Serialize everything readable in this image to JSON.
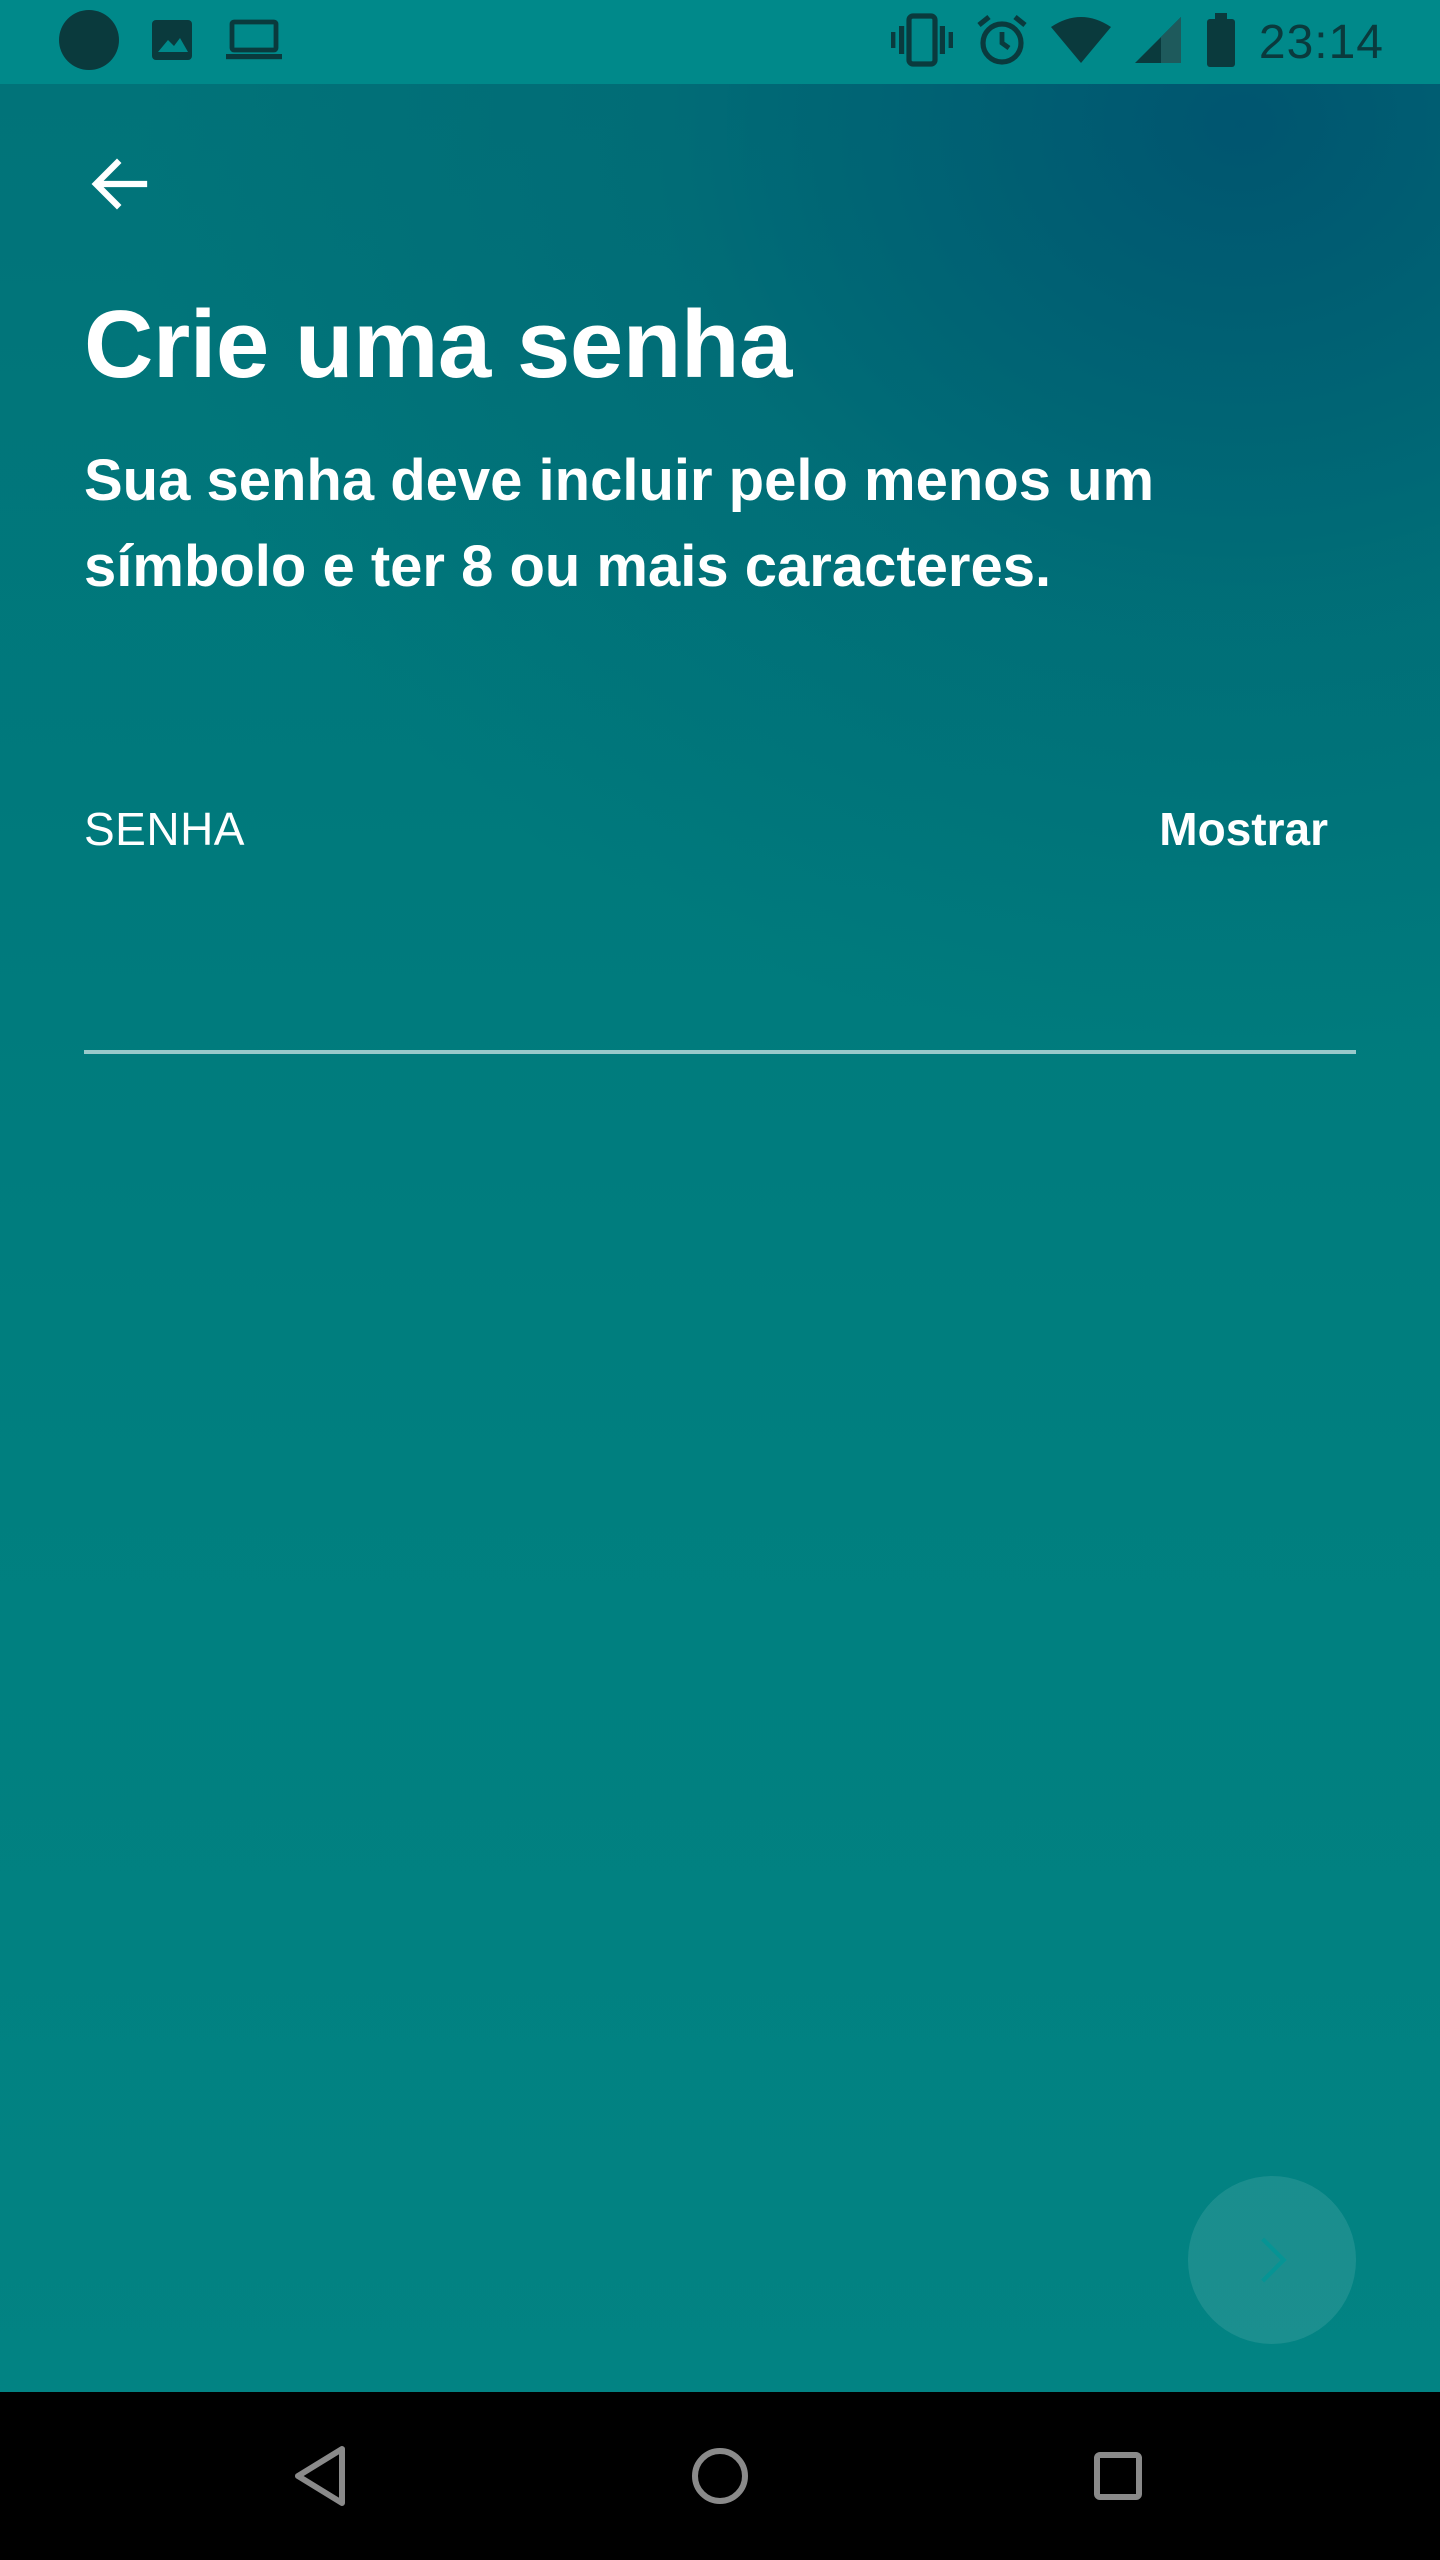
{
  "status_bar": {
    "time": "23:14",
    "left_icons": [
      "notification-dot-icon",
      "image-icon",
      "laptop-icon"
    ],
    "right_icons": [
      "vibrate-icon",
      "alarm-icon",
      "wifi-icon",
      "signal-icon",
      "battery-icon"
    ]
  },
  "header": {
    "back_icon": "arrow-left-icon",
    "title": "Crie uma senha",
    "subtitle": "Sua senha deve incluir pelo menos um símbolo e ter 8 ou mais caracteres."
  },
  "password_field": {
    "label": "SENHA",
    "show_label": "Mostrar",
    "value": ""
  },
  "next_button": {
    "icon": "chevron-right-icon"
  },
  "nav_bar": {
    "icons": [
      "back-triangle-icon",
      "home-circle-icon",
      "recents-square-icon"
    ]
  },
  "colors": {
    "background": "#00807f",
    "status_bar": "#00898a",
    "text": "#ffffff"
  }
}
